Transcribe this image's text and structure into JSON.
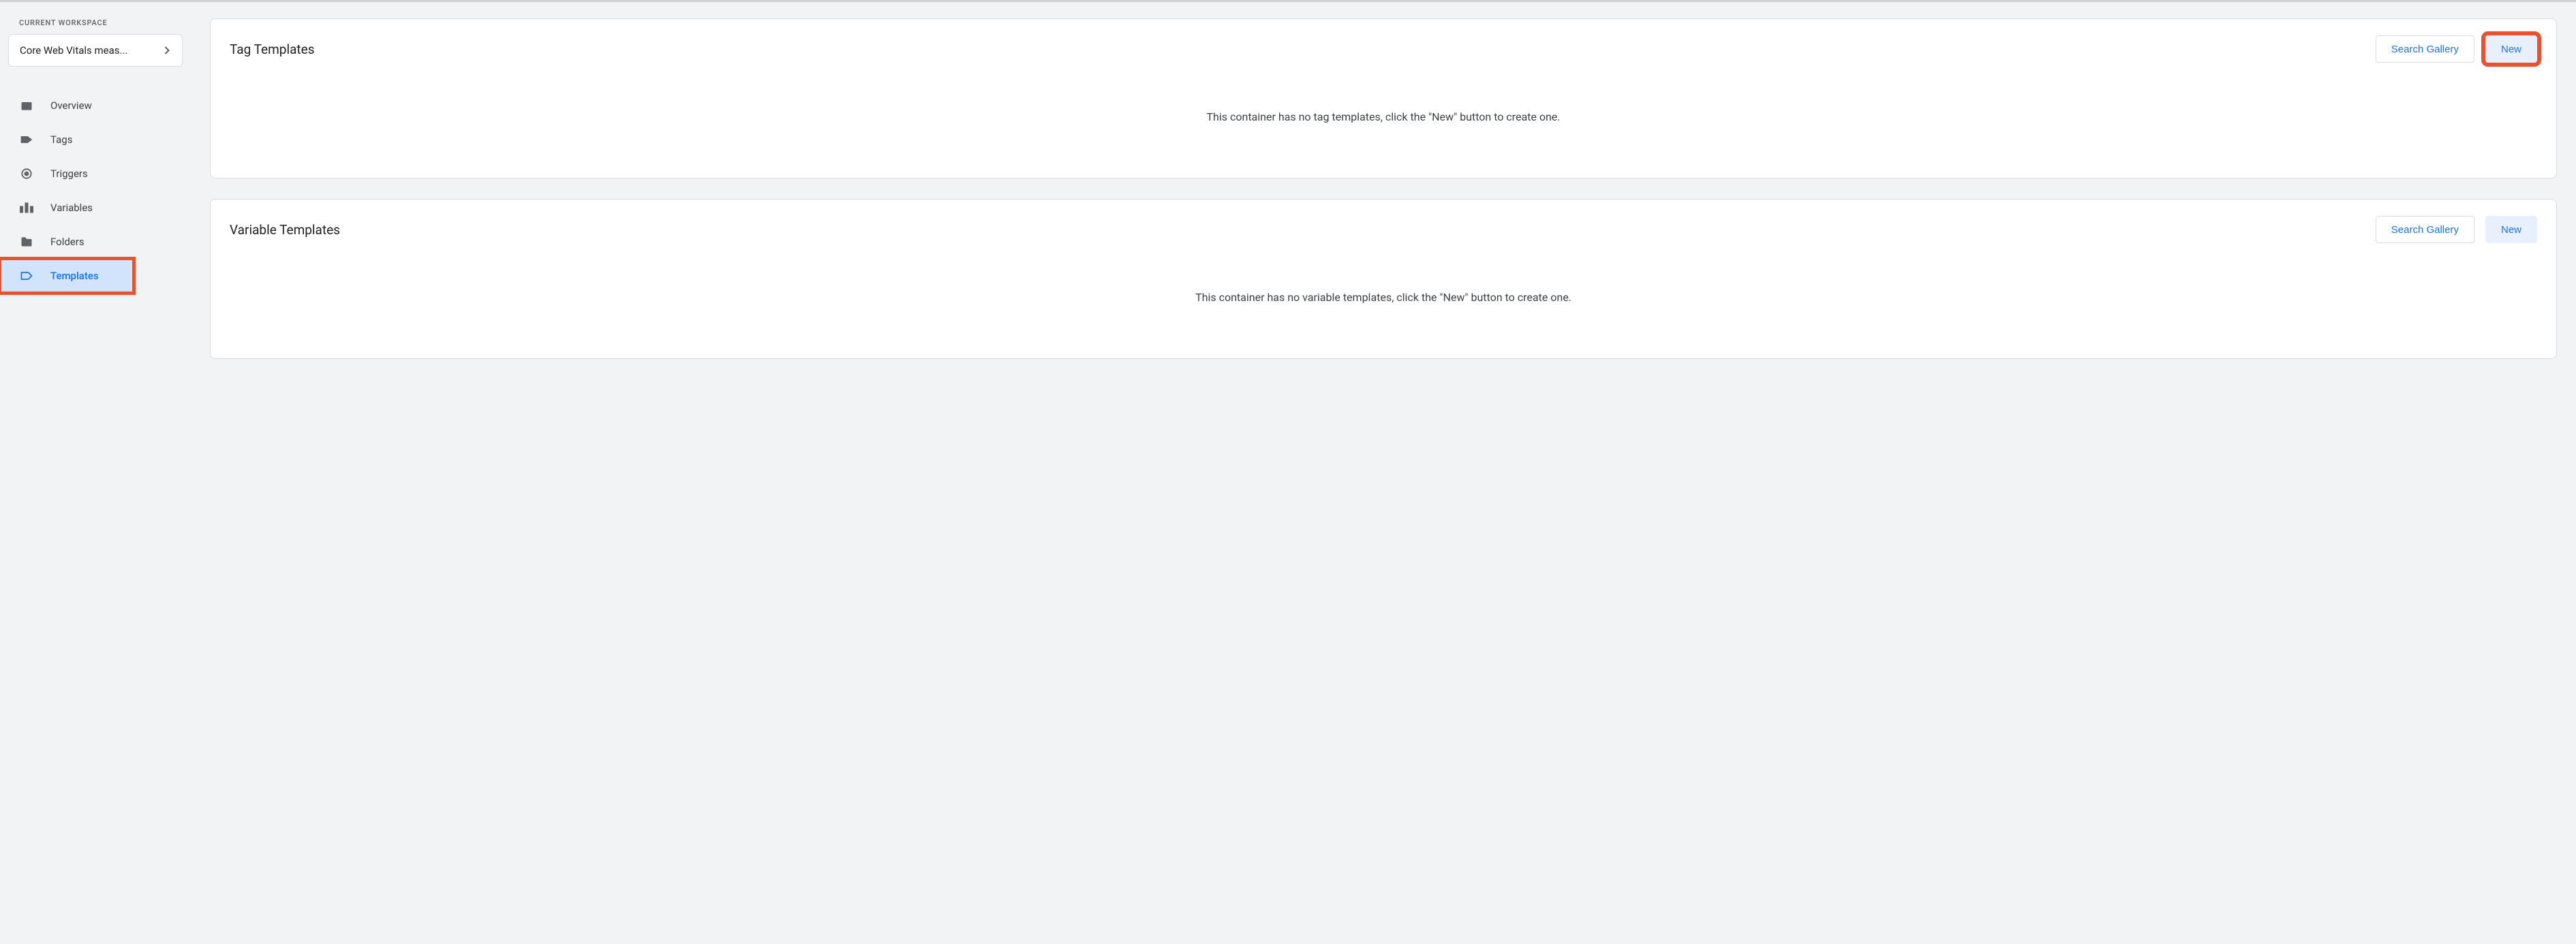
{
  "sidebar": {
    "workspace_heading": "CURRENT WORKSPACE",
    "workspace_name": "Core Web Vitals meas...",
    "items": [
      {
        "label": "Overview",
        "icon": "dashboard-icon",
        "active": false
      },
      {
        "label": "Tags",
        "icon": "tag-icon",
        "active": false
      },
      {
        "label": "Triggers",
        "icon": "target-icon",
        "active": false
      },
      {
        "label": "Variables",
        "icon": "blocks-icon",
        "active": false
      },
      {
        "label": "Folders",
        "icon": "folder-icon",
        "active": false
      },
      {
        "label": "Templates",
        "icon": "template-icon",
        "active": true
      }
    ]
  },
  "panels": {
    "tag_templates": {
      "title": "Tag Templates",
      "search_label": "Search Gallery",
      "new_label": "New",
      "empty_message": "This container has no tag templates, click the \"New\" button to create one."
    },
    "variable_templates": {
      "title": "Variable Templates",
      "search_label": "Search Gallery",
      "new_label": "New",
      "empty_message": "This container has no variable templates, click the \"New\" button to create one."
    }
  },
  "highlights": {
    "templates_nav": true,
    "tag_templates_new": true
  }
}
